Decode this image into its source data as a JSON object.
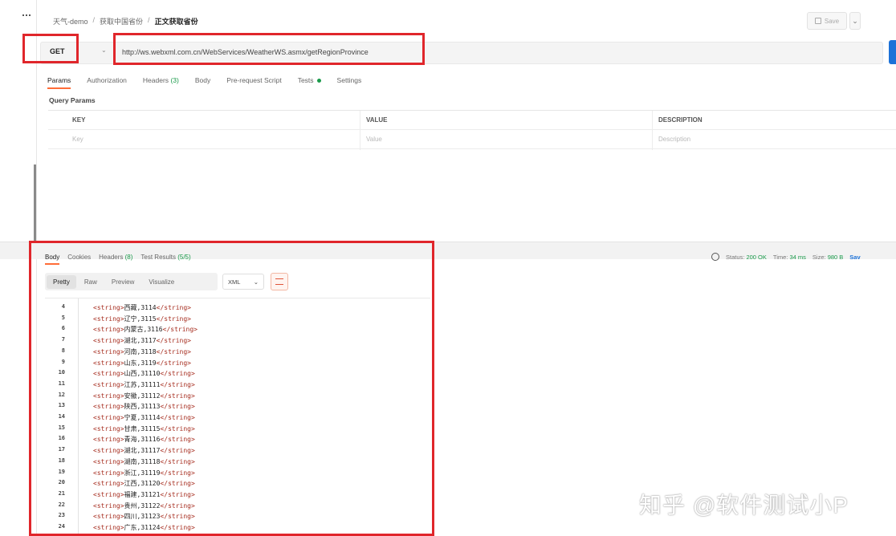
{
  "breadcrumb": [
    "天气-demo",
    "获取中国省份",
    "正文获取省份"
  ],
  "toolbar": {
    "save_label": "Save"
  },
  "request": {
    "method": "GET",
    "url": "http://ws.webxml.com.cn/WebServices/WeatherWS.asmx/getRegionProvince"
  },
  "request_tabs": [
    {
      "label": "Params"
    },
    {
      "label": "Authorization"
    },
    {
      "label": "Headers",
      "count": "(3)"
    },
    {
      "label": "Body"
    },
    {
      "label": "Pre-request Script"
    },
    {
      "label": "Tests"
    },
    {
      "label": "Settings"
    }
  ],
  "query_params": {
    "title": "Query Params",
    "columns": [
      "KEY",
      "VALUE",
      "DESCRIPTION"
    ],
    "placeholders": [
      "Key",
      "Value",
      "Description"
    ]
  },
  "response_tabs": [
    {
      "label": "Body"
    },
    {
      "label": "Cookies"
    },
    {
      "label": "Headers",
      "count": "(8)"
    },
    {
      "label": "Test Results",
      "count": "(5/5)"
    }
  ],
  "response_status": {
    "status_label": "Status:",
    "status_value": "200 OK",
    "time_label": "Time:",
    "time_value": "34 ms",
    "size_label": "Size:",
    "size_value": "980 B",
    "save_label": "Sav"
  },
  "view_modes": [
    "Pretty",
    "Raw",
    "Preview",
    "Visualize"
  ],
  "format": "XML",
  "code_lines": [
    {
      "n": "4",
      "text": "<string>西藏,3114</string>"
    },
    {
      "n": "5",
      "text": "<string>辽宁,3115</string>"
    },
    {
      "n": "6",
      "text": "<string>内蒙古,3116</string>"
    },
    {
      "n": "7",
      "text": "<string>湖北,3117</string>"
    },
    {
      "n": "8",
      "text": "<string>河南,3118</string>"
    },
    {
      "n": "9",
      "text": "<string>山东,3119</string>"
    },
    {
      "n": "10",
      "text": "<string>山西,31110</string>"
    },
    {
      "n": "11",
      "text": "<string>江苏,31111</string>"
    },
    {
      "n": "12",
      "text": "<string>安徽,31112</string>"
    },
    {
      "n": "13",
      "text": "<string>陕西,31113</string>"
    },
    {
      "n": "14",
      "text": "<string>宁夏,31114</string>"
    },
    {
      "n": "15",
      "text": "<string>甘肃,31115</string>"
    },
    {
      "n": "16",
      "text": "<string>青海,31116</string>"
    },
    {
      "n": "17",
      "text": "<string>湖北,31117</string>"
    },
    {
      "n": "18",
      "text": "<string>湖南,31118</string>"
    },
    {
      "n": "19",
      "text": "<string>浙江,31119</string>"
    },
    {
      "n": "20",
      "text": "<string>江西,31120</string>"
    },
    {
      "n": "21",
      "text": "<string>福建,31121</string>"
    },
    {
      "n": "22",
      "text": "<string>贵州,31122</string>"
    },
    {
      "n": "23",
      "text": "<string>四川,31123</string>"
    },
    {
      "n": "24",
      "text": "<string>广东,31124</string>"
    }
  ],
  "watermark": "知乎 @软件测试小P",
  "colors": {
    "highlight_red": "#e0262b",
    "accent": "#ff6c37",
    "send_blue": "#1d72d8",
    "ok_green": "#1a9a4a",
    "xml_tag": "#a62c1e"
  }
}
